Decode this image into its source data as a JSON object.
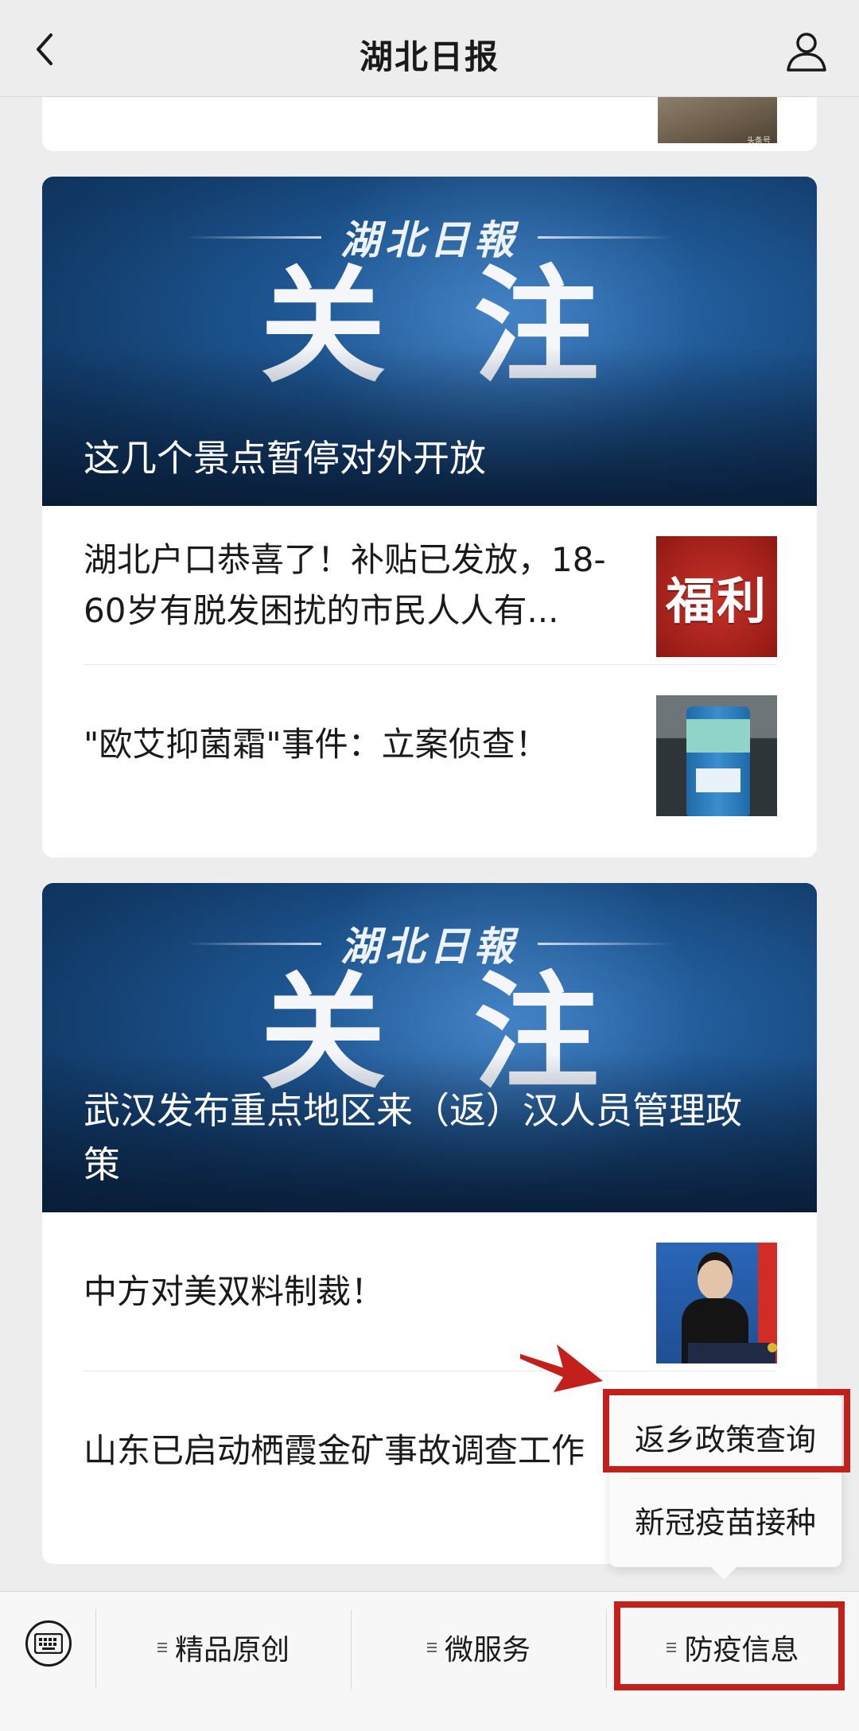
{
  "header": {
    "title": "湖北日报"
  },
  "top_card": {
    "thumb_caption": "头条号"
  },
  "sections": [
    {
      "banner": {
        "logo_text": "湖北日報",
        "big_text": "关注",
        "headline": "这几个景点暂停对外开放"
      },
      "items": [
        {
          "title": "湖北户口恭喜了！补贴已发放，18-60岁有脱发困扰的市民人人有...",
          "thumb_text": "福利"
        },
        {
          "title": "\"欧艾抑菌霜\"事件：立案侦查！"
        }
      ]
    },
    {
      "banner": {
        "logo_text": "湖北日報",
        "big_text": "关注",
        "headline": "武汉发布重点地区来（返）汉人员管理政策"
      },
      "items": [
        {
          "title": "中方对美双料制裁！"
        },
        {
          "title": "山东已启动栖霞金矿事故调查工作"
        }
      ]
    }
  ],
  "menu": {
    "items": [
      "精品原创",
      "微服务",
      "防疫信息"
    ],
    "popup": [
      "返乡政策查询",
      "新冠疫苗接种"
    ]
  },
  "colors": {
    "highlight": "#c3201c",
    "banner_blue": "#1d548f"
  }
}
